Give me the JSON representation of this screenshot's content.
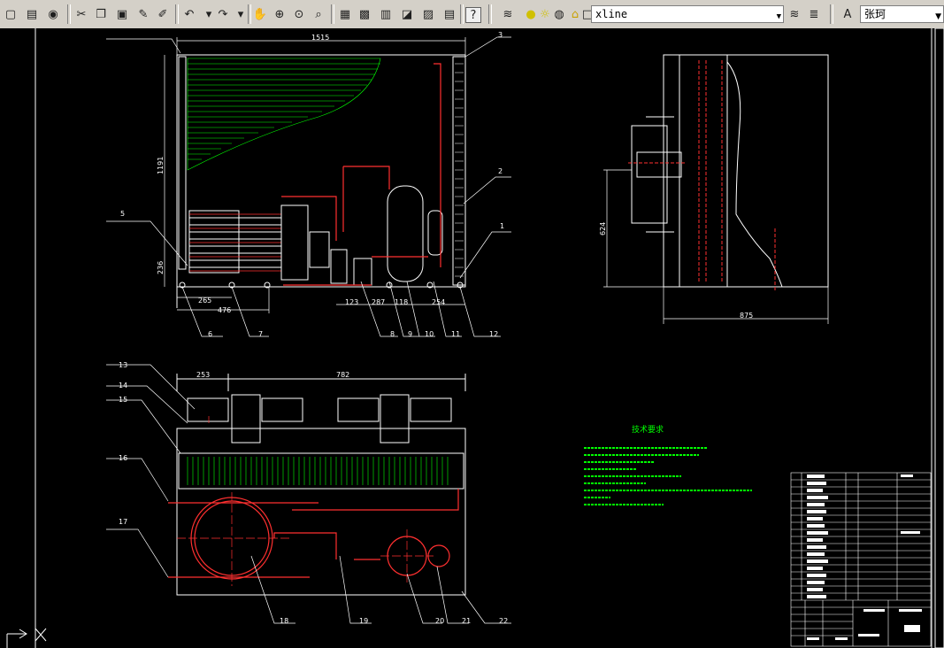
{
  "toolbar": {
    "layer_combo_value": "xline",
    "text_style_value": "张珂",
    "buttons": [
      "new-icon",
      "open-icon",
      "save-icon",
      "print-icon",
      "cut-icon",
      "copy-icon",
      "paste-icon",
      "match-prop-icon",
      "brush-icon",
      "undo-icon",
      "redo-icon",
      "pan-icon",
      "zoom-realtime-icon",
      "zoom-window-icon",
      "zoom-previous-icon",
      "properties-icon",
      "design-center-icon",
      "tool-palette-icon",
      "sheet-set-icon",
      "markup-icon",
      "calc-icon",
      "help-icon",
      "layer-icon",
      "text-style-icon"
    ]
  },
  "drawing": {
    "front_view": {
      "dims": {
        "width_top": "1515",
        "height_left": "1191",
        "d236": "236",
        "d265": "265",
        "d476": "476",
        "d123": "123",
        "d287": "287",
        "d118": "118",
        "d254": "254"
      },
      "callouts": [
        "3",
        "2",
        "1",
        "5",
        "6",
        "7",
        "8",
        "9",
        "10",
        "11",
        "12"
      ]
    },
    "side_view": {
      "dims": {
        "height": "624",
        "width": "875"
      }
    },
    "top_view": {
      "dims": {
        "d253": "253",
        "d782": "782"
      },
      "callouts": [
        "13",
        "14",
        "15",
        "16",
        "17",
        "18",
        "19",
        "20",
        "21",
        "22"
      ]
    },
    "notes_title": "技术要求"
  }
}
